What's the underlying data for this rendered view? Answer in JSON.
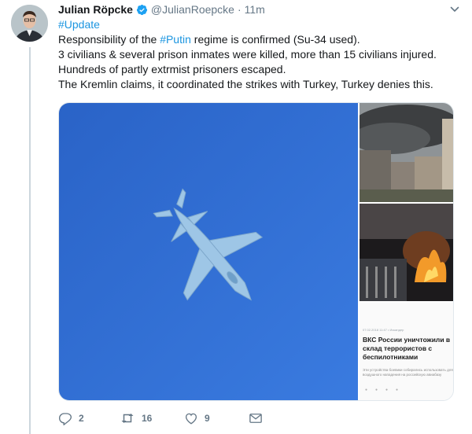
{
  "tweet": {
    "display_name": "Julian Röpcke",
    "handle": "@JulianRoepcke",
    "separator": "·",
    "time": "11m",
    "lines": [
      {
        "pre": "",
        "tag": "#Update",
        "post": ""
      },
      {
        "pre": "Responsibility of the ",
        "tag": "#Putin",
        "post": " regime is confirmed (Su-34 used)."
      },
      {
        "pre": "3 civilians & several prison inmates were killed, more than 15 civilians injured.",
        "tag": "",
        "post": ""
      },
      {
        "pre": "Hundreds of partly extrmist prisoners escaped.",
        "tag": "",
        "post": ""
      },
      {
        "pre": "The Kremlin claims, it coordinated the strikes with Turkey, Turkey denies this.",
        "tag": "",
        "post": ""
      }
    ],
    "news_card": {
      "meta": "07.02.2018 11:47 • Искандер",
      "headline": "ВКС России уничтожили в склад террористов с беспилотниками",
      "snippet": "Эти устройства боевики собирались использовать для воздушного нападения на российскую авиабазу"
    },
    "actions": {
      "replies": "2",
      "retweets": "16",
      "likes": "9"
    },
    "colors": {
      "link": "#1b95e0",
      "muted": "#657786",
      "sky": "#2f6fd0"
    }
  }
}
